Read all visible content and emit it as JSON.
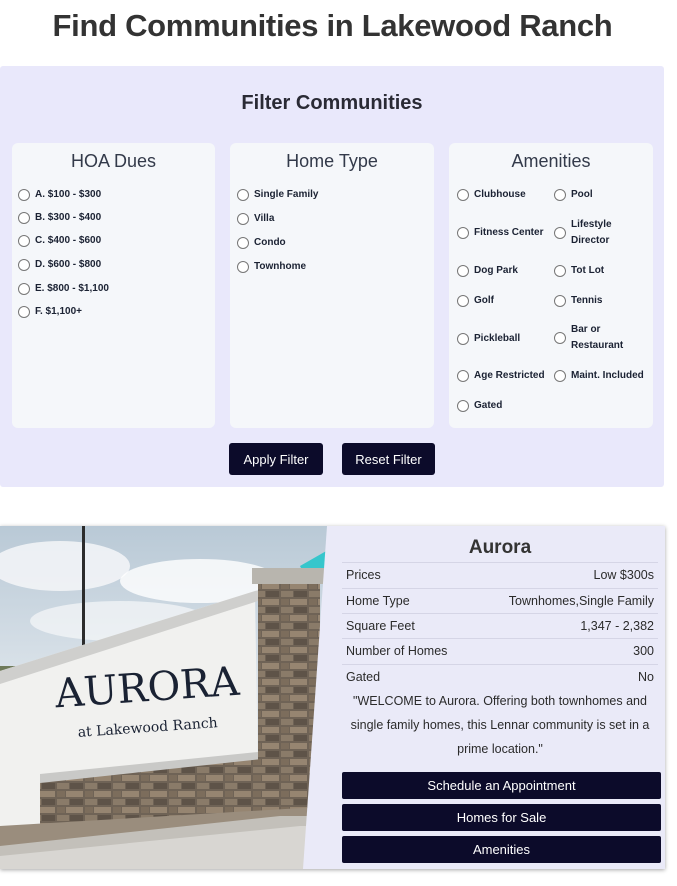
{
  "page": {
    "title": "Find Communities in Lakewood Ranch"
  },
  "filter": {
    "title": "Filter Communities",
    "hoa": {
      "title": "HOA Dues",
      "options": [
        "A. $100 - $300",
        "B. $300 - $400",
        "C. $400 - $600",
        "D. $600 - $800",
        "E. $800 - $1,100",
        "F. $1,100+"
      ]
    },
    "home_type": {
      "title": "Home Type",
      "options": [
        "Single Family",
        "Villa",
        "Condo",
        "Townhome"
      ]
    },
    "amenities": {
      "title": "Amenities",
      "left": [
        "Clubhouse",
        "Fitness Center",
        "Dog Park",
        "Golf",
        "Pickleball",
        "Age Restricted",
        "Gated"
      ],
      "right_single": [
        "Pool",
        "Tot Lot",
        "Tennis",
        "Maint. Included"
      ],
      "lifestyle": [
        "Lifestyle",
        "Director"
      ],
      "bar": [
        "Bar or",
        "Restaurant"
      ]
    },
    "apply_label": "Apply Filter",
    "reset_label": "Reset Filter"
  },
  "community": {
    "name": "Aurora",
    "sign_main": "AURORA",
    "sign_sub": "at Lakewood Ranch",
    "rows": [
      {
        "label": "Prices",
        "value": "Low $300s"
      },
      {
        "label": "Home Type",
        "value": "Townhomes,Single Family"
      },
      {
        "label": "Square Feet",
        "value": "1,347 - 2,382"
      },
      {
        "label": "Number of Homes",
        "value": "300"
      },
      {
        "label": "Gated",
        "value": "No"
      }
    ],
    "description_lines": [
      "\"WELCOME to Aurora. Offering both townhomes and",
      "single family homes, this Lennar community is set in a",
      "prime location.\""
    ],
    "buttons": [
      "Schedule an Appointment",
      "Homes for Sale",
      "Amenities"
    ]
  }
}
